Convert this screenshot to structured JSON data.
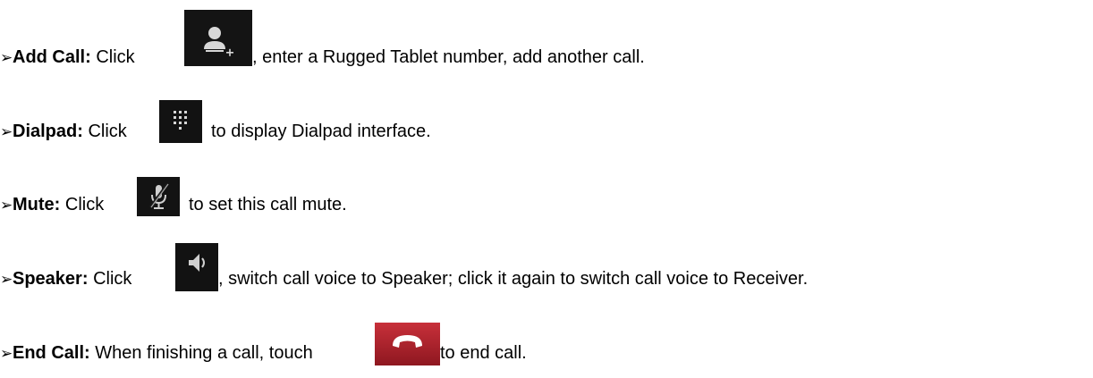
{
  "bullet": "➢",
  "items": [
    {
      "term": "Add Call:",
      "lead": "Click",
      "icon": "add-person-icon",
      "rest": ", enter a Rugged Tablet number, add another call."
    },
    {
      "term": "Dialpad:",
      "lead": "Click",
      "icon": "dialpad-icon",
      "rest": "to display Dialpad interface."
    },
    {
      "term": "Mute:",
      "lead": "Click",
      "icon": "mute-microphone-icon",
      "rest": "to set this call mute."
    },
    {
      "term": "Speaker:",
      "lead": "Click",
      "icon": "speaker-icon",
      "rest": ", switch call voice to Speaker; click it again to switch call voice to Receiver."
    },
    {
      "term": "End Call:",
      "lead": "When finishing a call, touch",
      "icon": "end-call-icon",
      "rest": "to end call."
    }
  ],
  "colors": {
    "icon_background": "#121212",
    "icon_glyph": "#dcdcdc",
    "end_call_button": "#b0212b",
    "end_call_glyph": "#ffffff"
  }
}
